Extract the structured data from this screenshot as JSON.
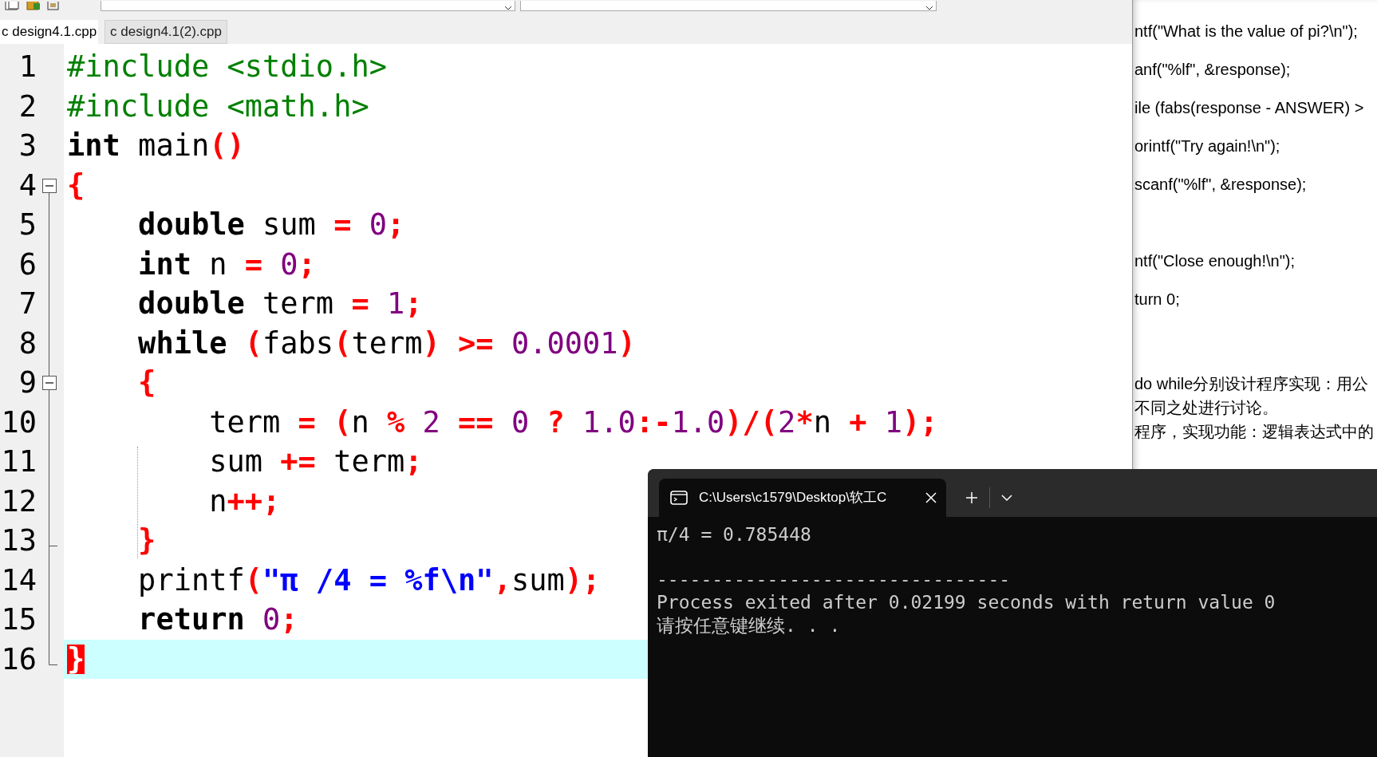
{
  "editor": {
    "tabs": [
      {
        "label": "c design4.1.cpp",
        "selected": true
      },
      {
        "label": "c design4.1(2).cpp",
        "selected": false
      }
    ],
    "lines": [
      {
        "number": "1",
        "current": false,
        "tokens": [
          {
            "kind": "preproc",
            "text": "#include <stdio.h>"
          }
        ]
      },
      {
        "number": "2",
        "current": false,
        "tokens": [
          {
            "kind": "preproc",
            "text": "#include <math.h>"
          }
        ]
      },
      {
        "number": "3",
        "current": false,
        "tokens": [
          {
            "kind": "keyword",
            "text": "int"
          },
          {
            "kind": "plain",
            "text": " main"
          },
          {
            "kind": "op",
            "text": "()"
          }
        ]
      },
      {
        "number": "4",
        "current": false,
        "expanded": true,
        "tokens": [
          {
            "kind": "op",
            "text": "{"
          }
        ]
      },
      {
        "number": "5",
        "current": false,
        "tokens": [
          {
            "kind": "keyword",
            "text": "    double"
          },
          {
            "kind": "plain",
            "text": " sum "
          },
          {
            "kind": "op",
            "text": "="
          },
          {
            "kind": "number",
            "text": " 0"
          },
          {
            "kind": "op",
            "text": ";"
          }
        ]
      },
      {
        "number": "6",
        "current": false,
        "tokens": [
          {
            "kind": "keyword",
            "text": "    int"
          },
          {
            "kind": "plain",
            "text": " n "
          },
          {
            "kind": "op",
            "text": "="
          },
          {
            "kind": "number",
            "text": " 0"
          },
          {
            "kind": "op",
            "text": ";"
          }
        ]
      },
      {
        "number": "7",
        "current": false,
        "tokens": [
          {
            "kind": "keyword",
            "text": "    double"
          },
          {
            "kind": "plain",
            "text": " term "
          },
          {
            "kind": "op",
            "text": "="
          },
          {
            "kind": "number",
            "text": " 1"
          },
          {
            "kind": "op",
            "text": ";"
          }
        ]
      },
      {
        "number": "8",
        "current": false,
        "tokens": [
          {
            "kind": "keyword",
            "text": "    while"
          },
          {
            "kind": "op",
            "text": " ("
          },
          {
            "kind": "plain",
            "text": "fabs"
          },
          {
            "kind": "op",
            "text": "("
          },
          {
            "kind": "plain",
            "text": "term"
          },
          {
            "kind": "op",
            "text": ") >="
          },
          {
            "kind": "number",
            "text": " 0.0001"
          },
          {
            "kind": "op",
            "text": ")"
          }
        ]
      },
      {
        "number": "9",
        "current": false,
        "expanded": true,
        "tokens": [
          {
            "kind": "op",
            "text": "    {"
          }
        ]
      },
      {
        "number": "10",
        "current": false,
        "tokens": [
          {
            "kind": "plain",
            "text": "        term "
          },
          {
            "kind": "op",
            "text": "= ("
          },
          {
            "kind": "plain",
            "text": "n "
          },
          {
            "kind": "op",
            "text": "%"
          },
          {
            "kind": "number",
            "text": " 2 "
          },
          {
            "kind": "op",
            "text": "=="
          },
          {
            "kind": "number",
            "text": " 0 "
          },
          {
            "kind": "op",
            "text": "?"
          },
          {
            "kind": "number",
            "text": " 1.0"
          },
          {
            "kind": "op",
            "text": ":-"
          },
          {
            "kind": "number",
            "text": "1.0"
          },
          {
            "kind": "op",
            "text": ")/("
          },
          {
            "kind": "number",
            "text": "2"
          },
          {
            "kind": "op",
            "text": "*"
          },
          {
            "kind": "plain",
            "text": "n "
          },
          {
            "kind": "op",
            "text": "+"
          },
          {
            "kind": "number",
            "text": " 1"
          },
          {
            "kind": "op",
            "text": ");"
          }
        ]
      },
      {
        "number": "11",
        "current": false,
        "tokens": [
          {
            "kind": "plain",
            "text": "        sum "
          },
          {
            "kind": "op",
            "text": "+="
          },
          {
            "kind": "plain",
            "text": " term"
          },
          {
            "kind": "op",
            "text": ";"
          }
        ]
      },
      {
        "number": "12",
        "current": false,
        "tokens": [
          {
            "kind": "plain",
            "text": "        n"
          },
          {
            "kind": "op",
            "text": "++;"
          }
        ]
      },
      {
        "number": "13",
        "current": false,
        "block_end": true,
        "tokens": [
          {
            "kind": "op",
            "text": "    }"
          }
        ]
      },
      {
        "number": "14",
        "current": false,
        "tokens": [
          {
            "kind": "plain",
            "text": "    printf"
          },
          {
            "kind": "op",
            "text": "("
          },
          {
            "kind": "string",
            "text": "\"π /4 = %f\\n\""
          },
          {
            "kind": "op",
            "text": ","
          },
          {
            "kind": "plain",
            "text": "sum"
          },
          {
            "kind": "op",
            "text": ");"
          }
        ]
      },
      {
        "number": "15",
        "current": false,
        "tokens": [
          {
            "kind": "keyword",
            "text": "    return"
          },
          {
            "kind": "number",
            "text": " 0"
          },
          {
            "kind": "op",
            "text": ";"
          }
        ]
      },
      {
        "number": "16",
        "current": true,
        "block_end": true,
        "tokens": [
          {
            "kind": "match",
            "text": "}"
          }
        ]
      }
    ]
  },
  "document": {
    "code_lines": [
      "ntf(\"What is the value of pi?\\n\");",
      "anf(\"%lf\", &response);",
      "ile (fabs(response - ANSWER) >",
      "orintf(\"Try again!\\n\");",
      "scanf(\"%lf\", &response);"
    ],
    "code_lines_2": [
      "ntf(\"Close enough!\\n\");",
      "turn 0;"
    ],
    "text_lines": [
      "do while分别设计程序实现：用公",
      "不同之处进行讨论。",
      "程序，实现功能：逻辑表达式中的"
    ]
  },
  "terminal": {
    "tab_title": "C:\\Users\\c1579\\Desktop\\软工C",
    "output": [
      "π/4 = 0.785448",
      "--------------------------------",
      "Process exited after 0.02199 seconds with return value 0",
      "请按任意键继续. . ."
    ]
  }
}
